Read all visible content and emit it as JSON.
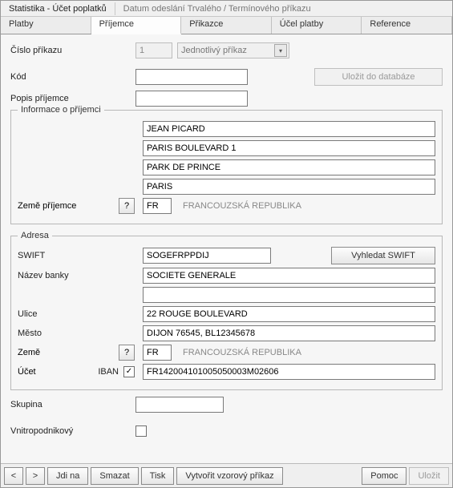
{
  "top": {
    "statistics": "Statistika - Účet poplatků",
    "sendinfo": "Datum odeslání Trvalého / Termínového příkazu"
  },
  "tabs": {
    "t0": "Platby",
    "t1": "Příjemce",
    "t2": "Přikazce",
    "t3": "Účel platby",
    "t4": "Reference"
  },
  "order": {
    "number_label": "Číslo příkazu",
    "number_value": "1",
    "type_value": "Jednotlivý příkaz"
  },
  "code": {
    "label": "Kód",
    "value": "",
    "save_db": "Uložit do databáze"
  },
  "recipient_desc_label": "Popis příjemce",
  "recipient_info": {
    "legend": "Informace o příjemci",
    "line1": "JEAN PICARD",
    "line2": "PARIS BOULEVARD 1",
    "line3": "PARK DE PRINCE",
    "line4": "PARIS",
    "country_label": "Země příjemce",
    "help": "?",
    "country_code": "FR",
    "country_name": "FRANCOUZSKÁ REPUBLIKA"
  },
  "address": {
    "legend": "Adresa",
    "swift_label": "SWIFT",
    "swift_value": "SOGEFRPPDIJ",
    "swift_lookup": "Vyhledat SWIFT",
    "bank_label": "Název banky",
    "bank_value": "SOCIETE GENERALE",
    "bank_line2": "",
    "street_label": "Ulice",
    "street_value": "22 ROUGE BOULEVARD",
    "city_label": "Město",
    "city_value": "DIJON 76545, BL12345678",
    "country_label": "Země",
    "help": "?",
    "country_code": "FR",
    "country_name": "FRANCOUZSKÁ REPUBLIKA",
    "account_label": "Účet",
    "iban_label": "IBAN",
    "iban_checked": "✓",
    "account_value": "FR142004101005050003M02606"
  },
  "group": {
    "label": "Skupina",
    "value": ""
  },
  "internal": {
    "label": "Vnitropodnikový"
  },
  "bottom": {
    "prev": "<",
    "next": ">",
    "goto": "Jdi na",
    "delete": "Smazat",
    "print": "Tisk",
    "create_template": "Vytvořit vzorový příkaz",
    "help": "Pomoc",
    "save": "Uložit"
  }
}
